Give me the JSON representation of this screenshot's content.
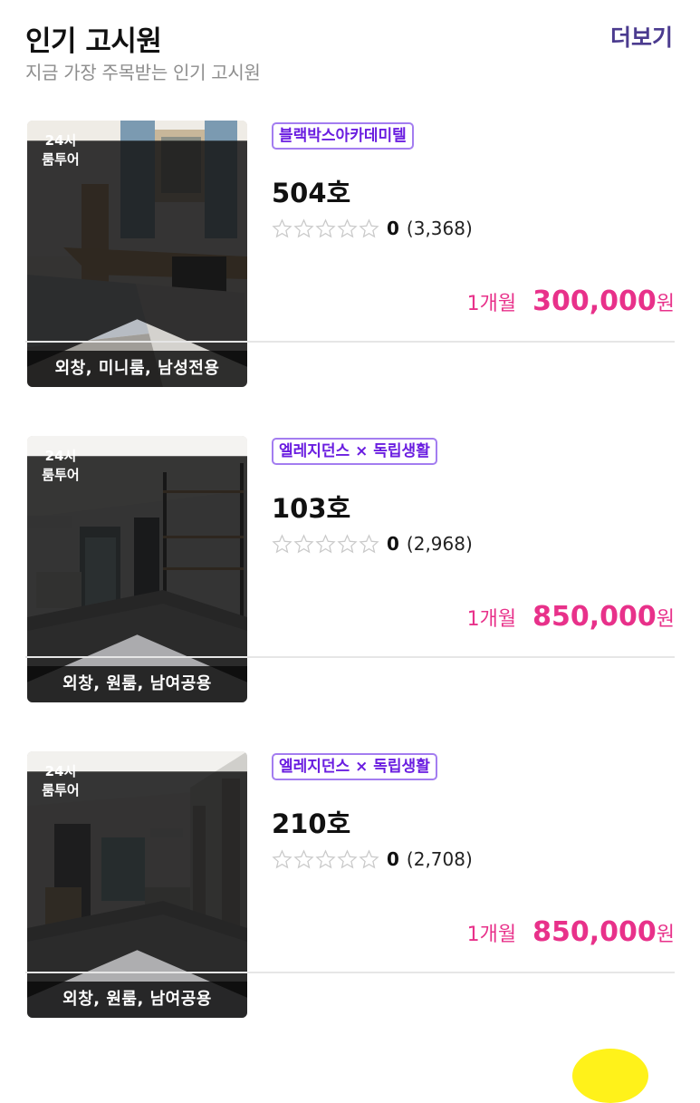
{
  "header": {
    "title": "인기 고시원",
    "subtitle": "지금 가장 주목받는 인기 고시원",
    "more_label": "더보기"
  },
  "listings": [
    {
      "tour_line1": "24시",
      "tour_line2": "룸투어",
      "caption": "외창, 미니룸, 남성전용",
      "brand": "블랙박스아카데미텔",
      "room": "504호",
      "rating_score": "0",
      "rating_count": "(3,368)",
      "price_period": "1개월",
      "price_amount": "300,000",
      "price_unit": "원"
    },
    {
      "tour_line1": "24시",
      "tour_line2": "룸투어",
      "caption": "외창, 원룸, 남여공용",
      "brand": "엘레지던스 × 독립생활",
      "room": "103호",
      "rating_score": "0",
      "rating_count": "(2,968)",
      "price_period": "1개월",
      "price_amount": "850,000",
      "price_unit": "원"
    },
    {
      "tour_line1": "24시",
      "tour_line2": "룸투어",
      "caption": "외창, 원룸, 남여공용",
      "brand": "엘레지던스 × 독립생활",
      "room": "210호",
      "rating_score": "0",
      "rating_count": "(2,708)",
      "price_period": "1개월",
      "price_amount": "850,000",
      "price_unit": "원"
    }
  ],
  "icons": {
    "star": "star-outline-icon",
    "tour_badge": "bookmark-badge"
  },
  "colors": {
    "accent_purple": "#4b3b8f",
    "brand_purple": "#6a1de0",
    "price_pink": "#e8318a",
    "fab_yellow": "#fff21a"
  }
}
